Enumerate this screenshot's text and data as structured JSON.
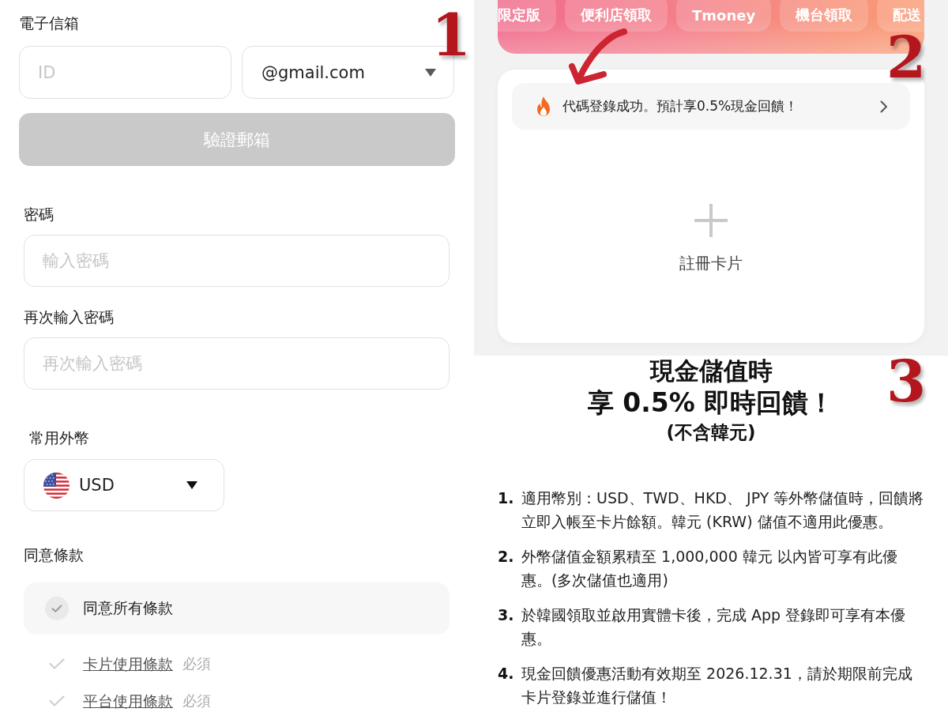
{
  "signup_form": {
    "annotation": "1",
    "email": {
      "label": "電子信箱",
      "id_placeholder": "ID",
      "domain": "@gmail.com",
      "verify_button": {
        "label": "驗證郵箱",
        "disabled": true
      }
    },
    "password": {
      "label": "密碼",
      "placeholder": "輸入密碼"
    },
    "confirm_password": {
      "label": "再次輸入密碼",
      "placeholder": "再次輸入密碼"
    },
    "currency": {
      "label": "常用外幣",
      "value": "USD"
    },
    "terms": {
      "label": "同意條款",
      "agree_all": {
        "label": "同意所有條款",
        "checked": false
      },
      "items": [
        {
          "label": "卡片使用條款",
          "tag": "必須",
          "checked": false
        },
        {
          "label": "平台使用條款",
          "tag": "必須",
          "checked": false
        }
      ]
    }
  },
  "card_screen": {
    "annotation": "2",
    "pickup_chips": [
      {
        "label": "限定版"
      },
      {
        "label": "便利店領取"
      },
      {
        "label": "Tmoney"
      },
      {
        "label": "機台領取"
      },
      {
        "label": "配送"
      }
    ],
    "notice": {
      "text": "代碼登錄成功。預計享0.5%現金回饋！"
    },
    "add_card": {
      "label": "註冊卡片"
    }
  },
  "promo": {
    "annotation": "3",
    "title_lines": [
      "現金儲值時",
      "享 0.5% 即時回饋！"
    ],
    "subtitle": "(不含韓元)",
    "rules": [
      {
        "number": "1.",
        "text": "適用幣別：USD、TWD、HKD、 JPY 等外幣儲值時，回饋將立即入帳至卡片餘額。韓元 (KRW) 儲值不適用此優惠。"
      },
      {
        "number": "2.",
        "text": "外幣儲值金額累積至 1,000,000 韓元 以內皆可享有此優惠。(多次儲值也適用)"
      },
      {
        "number": "3.",
        "text": "於韓國領取並啟用實體卡後，完成 App 登錄即可享有本優惠。"
      },
      {
        "number": "4.",
        "text": "現金回饋優惠活動有效期至 2026.12.31，請於期限前完成卡片登錄並進行儲值！"
      }
    ]
  }
}
